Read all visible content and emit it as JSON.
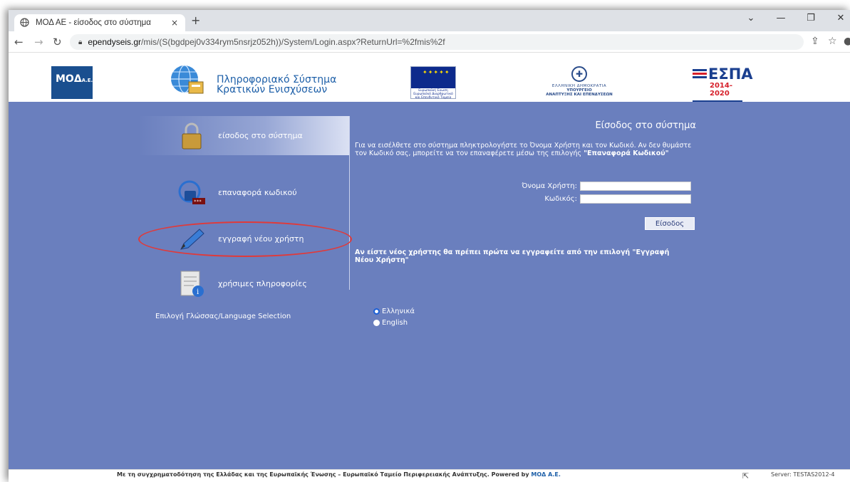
{
  "browser": {
    "tab_title": "ΜΟΔ ΑΕ - είσοδος στο σύστημα",
    "tab_close": "×",
    "new_tab": "+",
    "url_domain": "ependyseis.gr",
    "url_path": "/mis/(S(bgdpej0v334rym5nsrjz052h))/System/Login.aspx?ReturnUrl=%2fmis%2f",
    "back_icon": "back-arrow-icon",
    "forward_icon": "forward-arrow-icon",
    "reload_icon": "reload-icon"
  },
  "header": {
    "moa_logo_text": "ΜΟΔ",
    "moa_logo_suffix": "Α.Ε.",
    "pse_title_line1": "Πληροφοριακό Σύστημα",
    "pse_title_line2": "Κρατικών Ενισχύσεων",
    "eu_caption": "Ευρωπαϊκή Ένωση Ευρωπαϊκό Διαρθρωτικό και Επενδυτικό Ταμείο",
    "greek_ministry_l1": "ΕΛΛΗΝΙΚΗ ΔΗΜΟΚΡΑΤΙΑ",
    "greek_ministry_l2": "ΥΠΟΥΡΓΕΙΟ",
    "greek_ministry_l3": "ΑΝΑΠΤΥΞΗΣ ΚΑΙ ΕΠΕΝΔΥΣΕΩΝ",
    "espa_word": "ΕΣΠΑ",
    "espa_years": "2014-2020"
  },
  "sidebar": {
    "items": [
      {
        "label": "είσοδος στο σύστημα",
        "icon": "padlock-icon"
      },
      {
        "label": "επαναφορά κωδικού",
        "icon": "lock-reset-icon"
      },
      {
        "label": "εγγραφή νέου χρήστη",
        "icon": "pen-icon"
      },
      {
        "label": "χρήσιμες πληροφορίες",
        "icon": "document-info-icon"
      }
    ]
  },
  "login": {
    "title": "Είσοδος στο σύστημα",
    "intro_text": "Για να εισέλθετε στο σύστημα πληκτρολογήστε το Όνομα Χρήστη και τον Κωδικό. Αν δεν θυμάστε τον Κωδικό σας, μπορείτε να τον επαναφέρετε μέσω της επιλογής",
    "intro_link": "\"Επαναφορά Κωδικού\"",
    "username_label": "Όνομα Χρήστη:",
    "username_value": "",
    "password_label": "Κωδικός:",
    "password_value": "",
    "submit_label": "Είσοδος",
    "new_user_note_text": "Αν είστε νέος χρήστης θα πρέπει πρώτα να εγγραφείτε από την επιλογή",
    "new_user_note_link": "\"Εγγραφή Νέου Χρήστη\""
  },
  "language": {
    "label": "Επιλογή Γλώσσας/Language Selection",
    "options": [
      {
        "label": "Ελληνικά",
        "selected": true
      },
      {
        "label": "English",
        "selected": false
      }
    ]
  },
  "footer": {
    "credit": "Με τη συγχρηματοδότηση της Ελλάδας και της Ευρωπαϊκής Ένωσης – Ευρωπαϊκό Ταμείο Περιφερειακής Ανάπτυξης.  Powered by",
    "brand": "ΜΟΔ Α.Ε.",
    "server": "Server: TESTAS2012-4"
  },
  "colors": {
    "main_bg": "#6a7fbe",
    "highlight": "#e03a3a",
    "brand_blue": "#1d5fa8"
  }
}
